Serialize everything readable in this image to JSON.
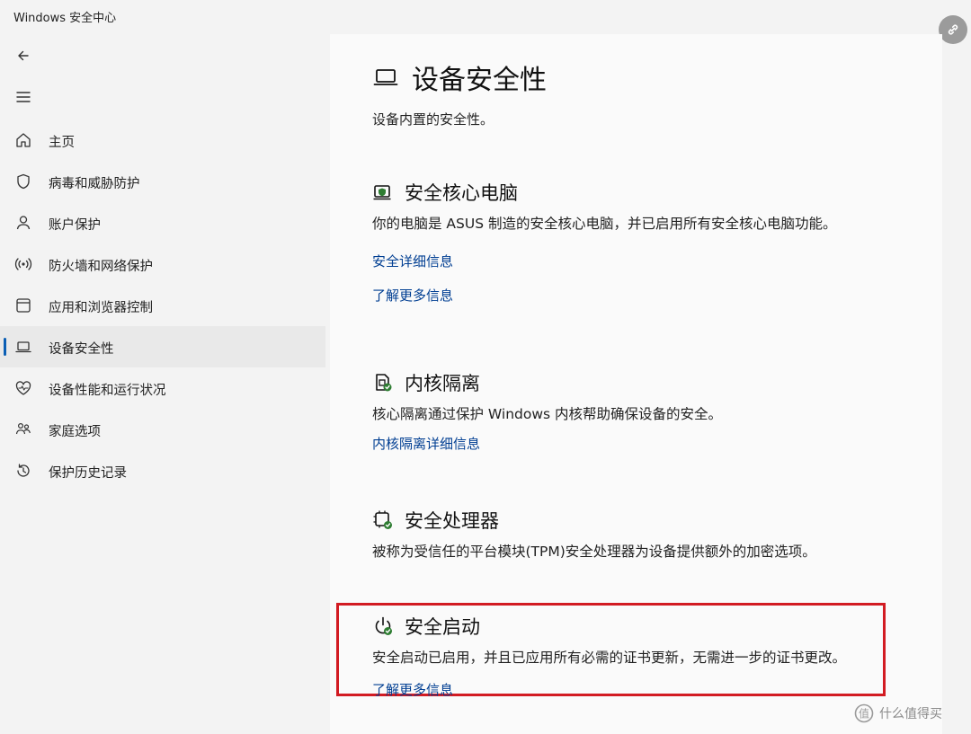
{
  "app": {
    "title": "Windows 安全中心"
  },
  "nav": {
    "back_icon": "back-arrow-icon",
    "menu_icon": "hamburger-menu-icon"
  },
  "sidebar": {
    "items": [
      {
        "label": "主页",
        "icon": "home-icon"
      },
      {
        "label": "病毒和威胁防护",
        "icon": "shield-icon"
      },
      {
        "label": "账户保护",
        "icon": "person-icon"
      },
      {
        "label": "防火墙和网络保护",
        "icon": "wifi-antenna-icon"
      },
      {
        "label": "应用和浏览器控制",
        "icon": "app-window-icon"
      },
      {
        "label": "设备安全性",
        "icon": "laptop-icon",
        "active": true
      },
      {
        "label": "设备性能和运行状况",
        "icon": "heart-pulse-icon"
      },
      {
        "label": "家庭选项",
        "icon": "family-icon"
      },
      {
        "label": "保护历史记录",
        "icon": "history-icon"
      }
    ]
  },
  "page": {
    "title": "设备安全性",
    "subtitle": "设备内置的安全性。"
  },
  "sections": {
    "core": {
      "title": "安全核心电脑",
      "desc": "你的电脑是 ASUS 制造的安全核心电脑，并已启用所有安全核心电脑功能。",
      "link1": "安全详细信息",
      "link2": "了解更多信息"
    },
    "isolation": {
      "title": "内核隔离",
      "desc": "核心隔离通过保护 Windows 内核帮助确保设备的安全。",
      "link1": "内核隔离详细信息"
    },
    "processor": {
      "title": "安全处理器",
      "desc": "被称为受信任的平台模块(TPM)安全处理器为设备提供额外的加密选项。"
    },
    "boot": {
      "title": "安全启动",
      "desc": "安全启动已启用，并且已应用所有必需的证书更新，无需进一步的证书更改。",
      "link1": "了解更多信息"
    }
  },
  "watermark": {
    "text": "什么值得买"
  },
  "colors": {
    "accent": "#0b5fb5",
    "link": "#003e92",
    "highlight_box": "#d21b22"
  }
}
